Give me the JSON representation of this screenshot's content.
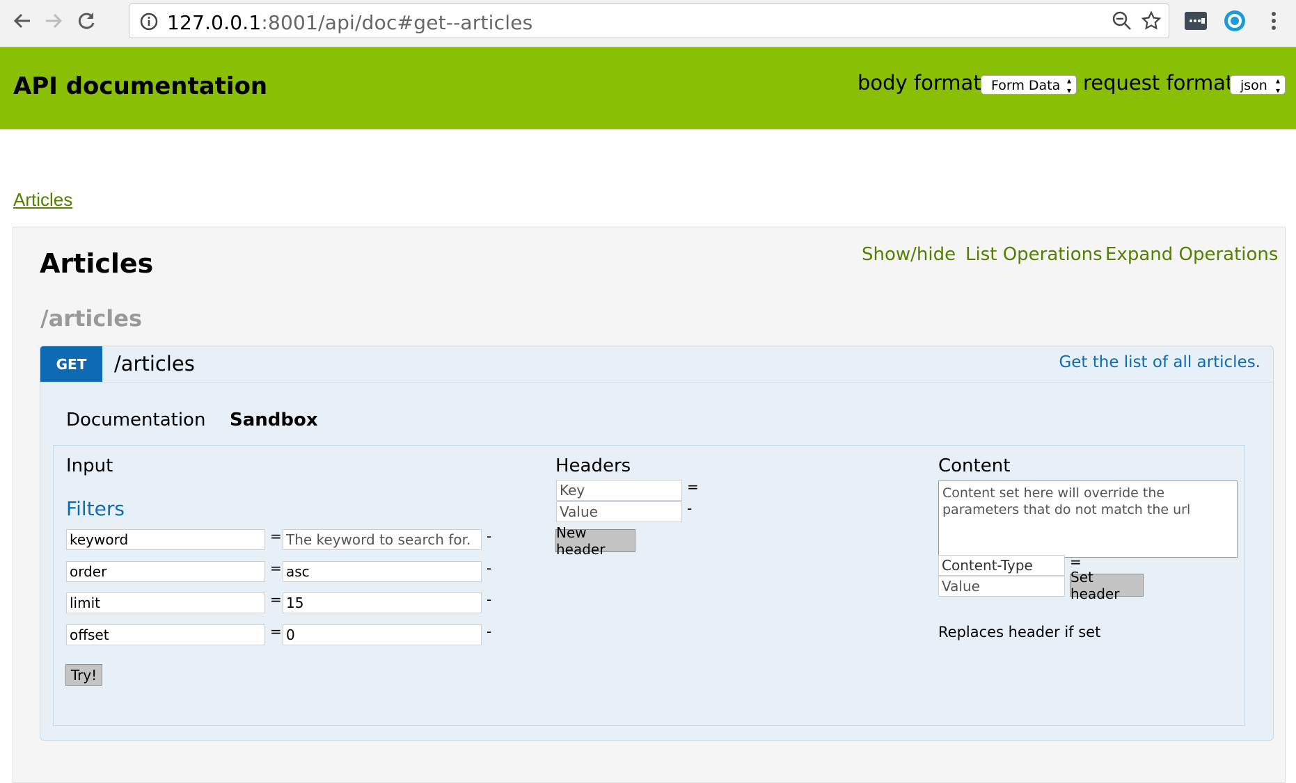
{
  "browser": {
    "url_host": "127.0.0.1",
    "url_rest": ":8001/api/doc#get--articles",
    "icons": [
      "back-icon",
      "forward-icon",
      "reload-icon",
      "info-icon",
      "zoom-icon",
      "star-icon",
      "extension-icon",
      "profile-icon",
      "menu-icon"
    ]
  },
  "header": {
    "title": "API documentation",
    "body_format_label": "body format:",
    "body_format_value": "Form Data",
    "request_format_label": "request format:",
    "request_format_value": "json",
    "bg_color": "#89bf04"
  },
  "top_link": "Articles",
  "resource": {
    "title": "Articles",
    "links": [
      "Show/hide",
      "List Operations",
      "Expand Operations"
    ],
    "path_heading": "/articles"
  },
  "operation": {
    "method": "GET",
    "path": "/articles",
    "description": "Get the list of all articles.",
    "tabs": [
      "Documentation",
      "Sandbox"
    ],
    "active_tab": "Sandbox"
  },
  "sandbox": {
    "input_title": "Input",
    "filters_title": "Filters",
    "params": [
      {
        "key": "keyword",
        "value": "",
        "placeholder": "The keyword to search for."
      },
      {
        "key": "order",
        "value": "asc",
        "placeholder": ""
      },
      {
        "key": "limit",
        "value": "15",
        "placeholder": ""
      },
      {
        "key": "offset",
        "value": "0",
        "placeholder": ""
      }
    ],
    "equals": "=",
    "dash": "-",
    "try_button": "Try!",
    "headers_title": "Headers",
    "header_key_placeholder": "Key",
    "header_value_placeholder": "Value",
    "new_header_button": "New header",
    "content_title": "Content",
    "content_placeholder": "Content set here will override the parameters that do not match the url",
    "content_type_value": "Content-Type",
    "content_value_placeholder": "Value",
    "set_header_button": "Set header",
    "replaces_text": "Replaces header if set"
  }
}
